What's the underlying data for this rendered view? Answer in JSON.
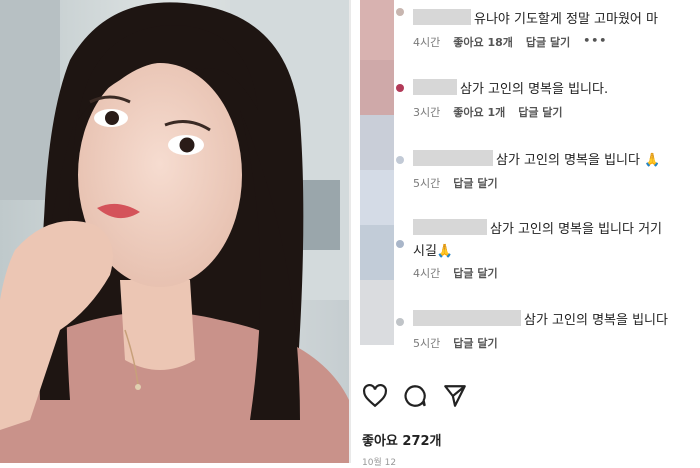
{
  "comments": [
    {
      "text": "유나야 기도할게 정말 고마웠어 마",
      "time": "4시간",
      "likes": "좋아요 18개",
      "reply": "답글 달기",
      "more": "•••"
    },
    {
      "text": "삼가 고인의 명복을 빕니다.",
      "time": "3시간",
      "likes": "좋아요 1개",
      "reply": "답글 달기"
    },
    {
      "text": "삼가 고인의 명복을 빕니다 🙏",
      "time": "5시간",
      "reply": "답글 달기"
    },
    {
      "text": "삼가 고인의 명복을 빕니다 거기",
      "text2": "시길🙏",
      "time": "4시간",
      "reply": "답글 달기"
    },
    {
      "text": "삼가 고인의 명복을 빕니다",
      "time": "5시간",
      "reply": "답글 달기"
    }
  ],
  "footer": {
    "likes": "좋아요 272개",
    "date": "10월 12"
  },
  "icons": {
    "like": "heart-icon",
    "comment": "comment-icon",
    "share": "send-icon"
  },
  "colors": {
    "text": "#222222",
    "meta": "#7a7a7a"
  }
}
